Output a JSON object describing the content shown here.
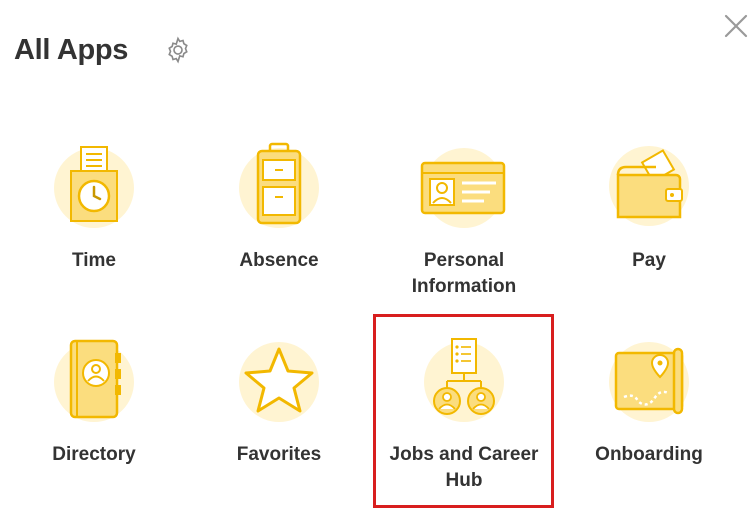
{
  "header": {
    "title": "All Apps",
    "settings_icon": "gear-icon",
    "close_icon": "close-icon"
  },
  "colors": {
    "icon_fill": "#FBDD7E",
    "icon_stroke": "#F2B800",
    "icon_bg": "#FFF4D2",
    "highlight": "#D81E1E",
    "text": "#333333"
  },
  "apps": [
    {
      "label": "Time",
      "icon": "time-clock-icon"
    },
    {
      "label": "Absence",
      "icon": "luggage-icon"
    },
    {
      "label": "Personal Information",
      "icon": "id-card-icon"
    },
    {
      "label": "Pay",
      "icon": "wallet-icon"
    },
    {
      "label": "Directory",
      "icon": "address-book-icon"
    },
    {
      "label": "Favorites",
      "icon": "star-icon"
    },
    {
      "label": "Jobs and Career Hub",
      "icon": "career-hub-icon"
    },
    {
      "label": "Onboarding",
      "icon": "onboarding-map-icon"
    }
  ],
  "highlighted_app": "Jobs and Career Hub"
}
